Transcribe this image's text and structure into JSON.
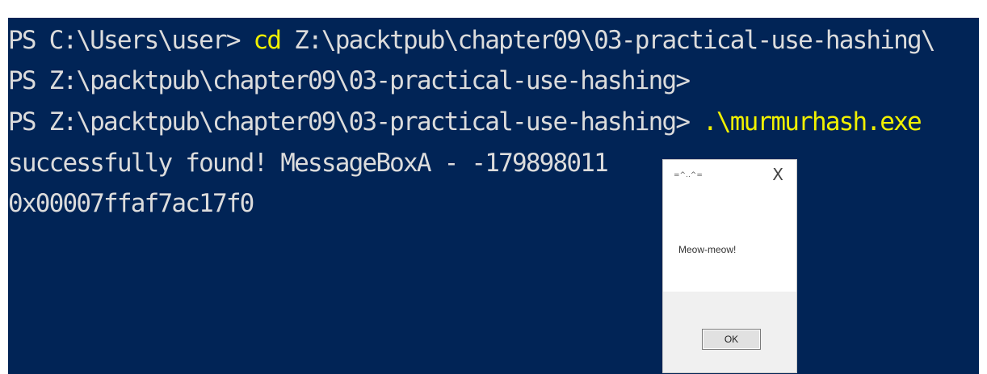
{
  "terminal": {
    "line1_prompt": "PS C:\\Users\\user> ",
    "line1_cmd": "cd",
    "line1_arg": " Z:\\packtpub\\chapter09\\03-practical-use-hashing\\",
    "line2": "PS Z:\\packtpub\\chapter09\\03-practical-use-hashing>",
    "line3_prompt": "PS Z:\\packtpub\\chapter09\\03-practical-use-hashing> ",
    "line3_cmd": ".\\murmurhash.exe",
    "line4": "successfully found! MessageBoxA - -179898011",
    "line5": "0x00007ffaf7ac17f0"
  },
  "messagebox": {
    "title": "=^..^=",
    "close_glyph": "X",
    "message": "Meow-meow!",
    "ok_label": "OK"
  },
  "colors": {
    "background": "#012456",
    "text": "#dcdcdc",
    "highlight": "#f0f000"
  }
}
